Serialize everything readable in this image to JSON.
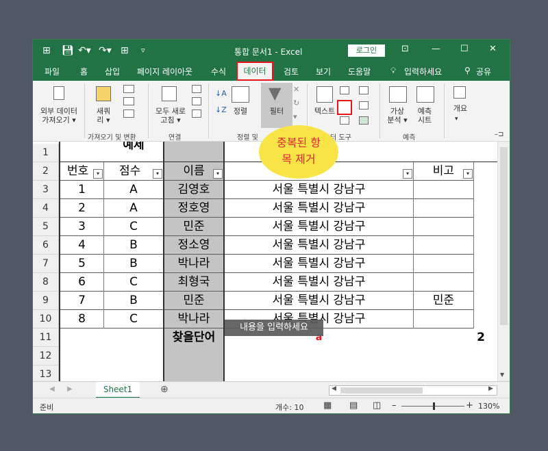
{
  "titlebar": {
    "title": "통합 문서1  -  Excel",
    "login": "로그인",
    "minimize": "—",
    "maximize": "☐",
    "close": "✕"
  },
  "tabs": [
    "파일",
    "홈",
    "삽입",
    "페이지 레이아웃",
    "수식",
    "데이터",
    "검토",
    "보기",
    "도움말"
  ],
  "active_tab": "데이터",
  "tell_me": "입력하세요",
  "share": "공유",
  "ribbon": {
    "get_external": "외부 데이터\n가져오기 ▾",
    "new_query": "새쿼\n리 ▾",
    "refresh_all": "모두 새로\n고침 ▾",
    "sort": "정렬",
    "filter": "필터",
    "text_to_columns": "텍스트",
    "what_if": "가상\n분석 ▾",
    "forecast_sheet": "예측\n시트",
    "outline": "개요",
    "group_labels": {
      "get_transform": "가져오기 및 변환",
      "connections": "연결",
      "sort_filter": "정렬 및",
      "data_tools": "터 도구",
      "forecast": "예측"
    }
  },
  "callout": "중복된 항\n목 제거",
  "tooltip": "내용을 입력하세요",
  "rows": [
    {
      "num": "1",
      "a": "",
      "b": "예제",
      "c": "",
      "d": "",
      "e": ""
    },
    {
      "num": "2",
      "a": "번호",
      "b": "점수",
      "c": "이름",
      "d": "",
      "e": "비고"
    },
    {
      "num": "3",
      "a": "1",
      "b": "A",
      "c": "김영호",
      "d": "서울 특별시 강남구",
      "e": ""
    },
    {
      "num": "4",
      "a": "2",
      "b": "A",
      "c": "정호영",
      "d": "서울 특별시 강남구",
      "e": ""
    },
    {
      "num": "5",
      "a": "3",
      "b": "C",
      "c": "민준",
      "d": "서울 특별시 강남구",
      "e": ""
    },
    {
      "num": "6",
      "a": "4",
      "b": "B",
      "c": "정소영",
      "d": "서울 특별시 강남구",
      "e": ""
    },
    {
      "num": "7",
      "a": "5",
      "b": "B",
      "c": "박나라",
      "d": "서울 특별시 강남구",
      "e": ""
    },
    {
      "num": "8",
      "a": "6",
      "b": "C",
      "c": "최형국",
      "d": "서울 특별시 강남구",
      "e": ""
    },
    {
      "num": "9",
      "a": "7",
      "b": "B",
      "c": "민준",
      "d": "서울 특별시 강남구",
      "e": "민준"
    },
    {
      "num": "10",
      "a": "8",
      "b": "C",
      "c": "박나라",
      "d": "서울 특별시 강남구",
      "e": ""
    },
    {
      "num": "11",
      "a": "",
      "b": "",
      "c": "찾을단어",
      "d": "a",
      "e": "2"
    },
    {
      "num": "12",
      "a": "",
      "b": "",
      "c": "",
      "d": "",
      "e": ""
    },
    {
      "num": "13",
      "a": "",
      "b": "",
      "c": "",
      "d": "",
      "e": ""
    }
  ],
  "sheet_tab": "Sheet1",
  "status": {
    "ready": "준비",
    "count": "개수: 10",
    "zoom": "130%"
  },
  "colors": {
    "accent": "#217346",
    "highlight_red": "#e8161a",
    "callout_yellow": "#f9e448"
  }
}
